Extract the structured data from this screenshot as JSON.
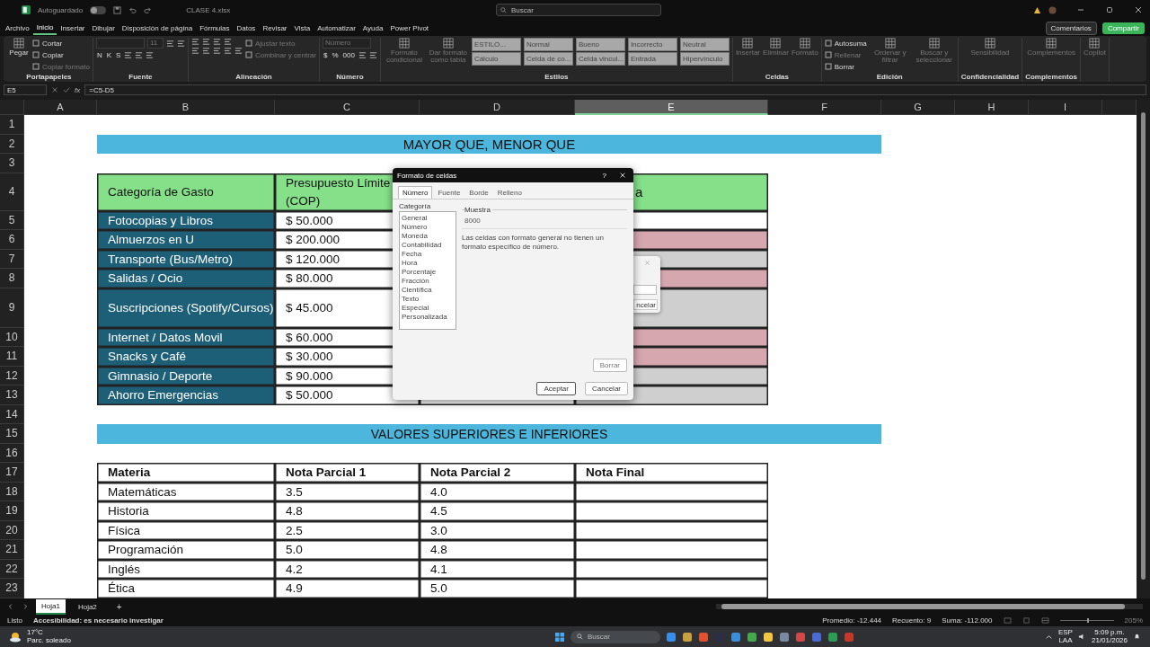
{
  "title_bar": {
    "autosave_label": "Autoguardado",
    "autosave_on": false,
    "file_name": "CLASE 4.xlsx",
    "search_placeholder": "Buscar"
  },
  "menu": [
    {
      "label": "Archivo",
      "selected": false
    },
    {
      "label": "Inicio",
      "selected": true
    },
    {
      "label": "Insertar",
      "selected": false
    },
    {
      "label": "Dibujar",
      "selected": false
    },
    {
      "label": "Disposición de página",
      "selected": false
    },
    {
      "label": "Fórmulas",
      "selected": false
    },
    {
      "label": "Datos",
      "selected": false
    },
    {
      "label": "Revisar",
      "selected": false
    },
    {
      "label": "Vista",
      "selected": false
    },
    {
      "label": "Automatizar",
      "selected": false
    },
    {
      "label": "Ayuda",
      "selected": false
    },
    {
      "label": "Power Pivot",
      "selected": false
    }
  ],
  "comments_button": "Comentarios",
  "share_button": "Compartir",
  "ribbon": [
    {
      "label": "Portapapeles",
      "columns": [
        [
          [
            {
              "kind": "big",
              "label": "Pegar",
              "disabled": false
            }
          ]
        ],
        [
          [
            {
              "kind": "small",
              "label": "Cortar",
              "disabled": false
            }
          ],
          [
            {
              "kind": "small",
              "label": "Copiar",
              "disabled": false
            }
          ],
          [
            {
              "kind": "small",
              "label": "Copiar formato",
              "disabled": true
            }
          ]
        ]
      ]
    },
    {
      "label": "Fuente",
      "columns": [
        [
          [
            {
              "kind": "select",
              "disabled": true
            },
            {
              "kind": "select",
              "value": "11",
              "disabled": true
            },
            {
              "kind": "icon"
            },
            {
              "kind": "icon"
            }
          ],
          [
            {
              "kind": "glyph",
              "label": "N"
            },
            {
              "kind": "glyph",
              "label": "K"
            },
            {
              "kind": "glyph",
              "label": "S"
            },
            {
              "kind": "icon"
            },
            {
              "kind": "icon"
            },
            {
              "kind": "icon"
            }
          ]
        ]
      ]
    },
    {
      "label": "Alineación",
      "columns": [
        [
          [
            {
              "kind": "icon"
            },
            {
              "kind": "icon"
            },
            {
              "kind": "icon"
            },
            {
              "kind": "icon"
            }
          ],
          [
            {
              "kind": "icon"
            },
            {
              "kind": "icon"
            },
            {
              "kind": "icon"
            },
            {
              "kind": "icon"
            },
            {
              "kind": "icon"
            }
          ]
        ],
        [
          [
            {
              "kind": "small",
              "label": "Ajustar texto",
              "disabled": true
            }
          ],
          [
            {
              "kind": "small",
              "label": "Combinar y centrar",
              "disabled": true
            }
          ]
        ]
      ]
    },
    {
      "label": "Número",
      "columns": [
        [
          [
            {
              "kind": "select",
              "value": "Número",
              "disabled": true
            }
          ],
          [
            {
              "kind": "glyph",
              "label": "$"
            },
            {
              "kind": "glyph",
              "label": "%"
            },
            {
              "kind": "glyph",
              "label": "000"
            },
            {
              "kind": "icon"
            },
            {
              "kind": "icon"
            }
          ]
        ]
      ]
    },
    {
      "label": "Estilos",
      "columns": [
        [
          [
            {
              "kind": "big",
              "label": "Formato condicional",
              "disabled": true
            }
          ]
        ],
        [
          [
            {
              "kind": "big",
              "label": "Dar formato como tabla",
              "disabled": true
            }
          ]
        ],
        [
          [
            {
              "kind": "style",
              "label": "ESTILO..."
            },
            {
              "kind": "style",
              "label": "Normal"
            },
            {
              "kind": "style",
              "label": "Bueno"
            },
            {
              "kind": "style",
              "label": "Incorrecto"
            },
            {
              "kind": "style",
              "label": "Neutral"
            }
          ],
          [
            {
              "kind": "style",
              "label": "Cálculo"
            },
            {
              "kind": "style",
              "label": "Celda de co..."
            },
            {
              "kind": "style",
              "label": "Celda vincul..."
            },
            {
              "kind": "style",
              "label": "Entrada"
            },
            {
              "kind": "style",
              "label": "Hipervínculo"
            }
          ]
        ]
      ]
    },
    {
      "label": "Celdas",
      "columns": [
        [
          [
            {
              "kind": "big",
              "label": "Insertar",
              "disabled": true
            }
          ]
        ],
        [
          [
            {
              "kind": "big",
              "label": "Eliminar",
              "disabled": true
            }
          ]
        ],
        [
          [
            {
              "kind": "big",
              "label": "Formato",
              "disabled": true
            }
          ]
        ]
      ]
    },
    {
      "label": "Edición",
      "columns": [
        [
          [
            {
              "kind": "small",
              "label": "Autosuma",
              "disabled": false
            }
          ],
          [
            {
              "kind": "small",
              "label": "Rellenar",
              "disabled": true
            }
          ],
          [
            {
              "kind": "small",
              "label": "Borrar",
              "disabled": false
            }
          ]
        ],
        [
          [
            {
              "kind": "big",
              "label": "Ordenar y filtrar",
              "disabled": true
            }
          ]
        ],
        [
          [
            {
              "kind": "big",
              "label": "Buscar y seleccionar",
              "disabled": true
            }
          ]
        ]
      ]
    },
    {
      "label": "Confidencialidad",
      "columns": [
        [
          [
            {
              "kind": "big",
              "label": "Sensibilidad",
              "disabled": true
            }
          ]
        ]
      ]
    },
    {
      "label": "Complementos",
      "columns": [
        [
          [
            {
              "kind": "big",
              "label": "Complementos",
              "disabled": true
            }
          ]
        ]
      ]
    },
    {
      "columns": [
        [
          [
            {
              "kind": "big",
              "label": "Copilot",
              "disabled": true
            }
          ]
        ]
      ]
    }
  ],
  "formula_bar": {
    "name_box": "E5",
    "function_label": "fx",
    "formula": "=C5-D5"
  },
  "columns": [
    {
      "label": "A",
      "selected": false
    },
    {
      "label": "B",
      "selected": false
    },
    {
      "label": "C",
      "selected": false
    },
    {
      "label": "D",
      "selected": false
    },
    {
      "label": "E",
      "selected": true
    },
    {
      "label": "F",
      "selected": false
    },
    {
      "label": "G",
      "selected": false
    },
    {
      "label": "H",
      "selected": false
    },
    {
      "label": "I",
      "selected": false
    }
  ],
  "row_numbers": [
    "1",
    "2",
    "3",
    "4",
    "5",
    "6",
    "7",
    "8",
    "9",
    "10",
    "11",
    "12",
    "13",
    "14",
    "15",
    "16",
    "17",
    "18",
    "19",
    "20",
    "21",
    "22",
    "23"
  ],
  "title_1": "MAYOR QUE, MENOR QUE",
  "budget_table": {
    "header": {
      "category": "Categoría de Gasto",
      "budget": "Presupuesto Límite (COP)",
      "column_e": "a"
    },
    "rows": [
      {
        "category": "Fotocopias y Libros",
        "budget": "$ 50.000",
        "color": "#ffffff"
      },
      {
        "category": "Almuerzos en U",
        "budget": "$ 200.000",
        "color": "#d7a7b0"
      },
      {
        "category": "Transporte (Bus/Metro)",
        "budget": "$ 120.000",
        "color": "#cfcfcf"
      },
      {
        "category": "Salidas / Ocio",
        "budget": "$ 80.000",
        "color": "#d7a7b0"
      },
      {
        "category": "Suscripciones (Spotify/Cursos)",
        "budget": "$ 45.000",
        "color": "#cfcfcf"
      },
      {
        "category": "Internet / Datos Movil",
        "budget": "$ 60.000",
        "color": "#d7a7b0"
      },
      {
        "category": "Snacks y Café",
        "budget": "$ 30.000",
        "color": "#d7a7b0"
      },
      {
        "category": "Gimnasio / Deporte",
        "budget": "$ 90.000",
        "color": "#cfcfcf"
      },
      {
        "category": "Ahorro Emergencias",
        "budget": "$ 50.000",
        "color": "#cfcfcf"
      }
    ]
  },
  "title_2": "VALORES SUPERIORES E INFERIORES",
  "grades_table": {
    "columns": [
      "Materia",
      "Nota Parcial 1",
      "Nota Parcial 2",
      "Nota Final"
    ],
    "rows": [
      {
        "subject": "Matemáticas",
        "grade_1": "3.5",
        "grade_2": "4.0"
      },
      {
        "subject": "Historia",
        "grade_1": "4.8",
        "grade_2": "4.5"
      },
      {
        "subject": "Física",
        "grade_1": "2.5",
        "grade_2": "3.0"
      },
      {
        "subject": "Programación",
        "grade_1": "5.0",
        "grade_2": "4.8"
      },
      {
        "subject": "Inglés",
        "grade_1": "4.2",
        "grade_2": "4.1"
      },
      {
        "subject": "Ética",
        "grade_1": "4.9",
        "grade_2": "5.0"
      }
    ]
  },
  "dialog": {
    "title": "Formato de celdas",
    "help": "?",
    "tabs": [
      {
        "label": "Número",
        "selected": true
      },
      {
        "label": "Fuente",
        "selected": false
      },
      {
        "label": "Borde",
        "selected": false
      },
      {
        "label": "Relleno",
        "selected": false
      }
    ],
    "category_label": "Categoría",
    "categories": [
      "General",
      "Número",
      "Moneda",
      "Contabilidad",
      "Fecha",
      "Hora",
      "Porcentaje",
      "Fracción",
      "Científica",
      "Texto",
      "Especial",
      "Personalizada"
    ],
    "sample_label": "Muestra",
    "sample_value": "8000",
    "description": "Las celdas con formato general no tienen un formato específico de número.",
    "clear_button": {
      "label": "Borrar",
      "disabled": true
    },
    "ok_button": "Aceptar",
    "cancel_button": "Cancelar"
  },
  "background_dialog": {
    "button": "ncelar"
  },
  "sheet_tabs": [
    {
      "label": "Hoja1",
      "selected": true
    },
    {
      "label": "Hoja2",
      "selected": false
    }
  ],
  "add_sheet": "+",
  "status_bar": {
    "ready": "Listo",
    "accessibility": "Accesibilidad: es necesario investigar",
    "average": "Promedio: -12.444",
    "count": "Recuento: 9",
    "sum": "Suma: -112.000",
    "zoom": "205%",
    "zoom_slider": {
      "level": 0.5
    }
  },
  "taskbar": {
    "temperature": "17°C",
    "weather": "Parc. soleado",
    "search_placeholder": "Buscar",
    "language": "ESP",
    "layout": "LAA",
    "time": "5:09 p.m.",
    "date": "21/01/2026"
  }
}
